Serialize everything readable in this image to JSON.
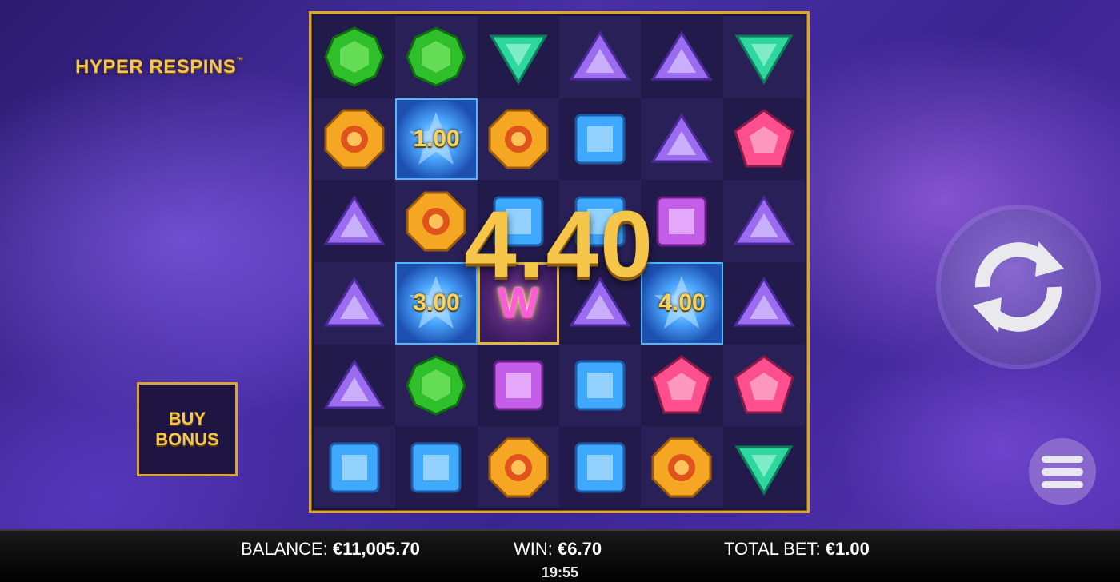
{
  "game": {
    "logo_text": "HYPER RESPINS",
    "logo_tm": "™"
  },
  "grid": {
    "rows": [
      [
        {
          "gem": "green-octagon"
        },
        {
          "gem": "green-octagon"
        },
        {
          "gem": "teal-triangle-down"
        },
        {
          "gem": "purple-triangle"
        },
        {
          "gem": "purple-triangle"
        },
        {
          "gem": "teal-triangle-down"
        }
      ],
      [
        {
          "gem": "orange-octagon"
        },
        {
          "gem": "star",
          "multiplier": "1.00"
        },
        {
          "gem": "orange-octagon"
        },
        {
          "gem": "blue-square"
        },
        {
          "gem": "purple-triangle"
        },
        {
          "gem": "pink-pentagon"
        }
      ],
      [
        {
          "gem": "purple-triangle"
        },
        {
          "gem": "orange-octagon"
        },
        {
          "gem": "blue-square"
        },
        {
          "gem": "blue-square"
        },
        {
          "gem": "magenta-square"
        },
        {
          "gem": "purple-triangle"
        }
      ],
      [
        {
          "gem": "purple-triangle"
        },
        {
          "gem": "star",
          "multiplier": "3.00"
        },
        {
          "gem": "wild",
          "letter": "W"
        },
        {
          "gem": "purple-triangle"
        },
        {
          "gem": "star",
          "multiplier": "4.00"
        },
        {
          "gem": "purple-triangle"
        }
      ],
      [
        {
          "gem": "purple-triangle"
        },
        {
          "gem": "green-octagon"
        },
        {
          "gem": "magenta-square"
        },
        {
          "gem": "blue-square"
        },
        {
          "gem": "pink-pentagon"
        },
        {
          "gem": "pink-pentagon"
        }
      ],
      [
        {
          "gem": "blue-square"
        },
        {
          "gem": "blue-square"
        },
        {
          "gem": "orange-octagon"
        },
        {
          "gem": "blue-square"
        },
        {
          "gem": "orange-octagon"
        },
        {
          "gem": "teal-triangle-down"
        }
      ]
    ],
    "big_win": "4.40"
  },
  "buy_bonus": {
    "line1": "BUY",
    "line2": "BONUS"
  },
  "controls": {
    "spin_icon": "refresh-icon",
    "menu_icon": "hamburger-icon"
  },
  "status": {
    "balance_label": "BALANCE:",
    "balance_value": "€11,005.70",
    "win_label": "WIN:",
    "win_value": "€6.70",
    "bet_label": "TOTAL BET:",
    "bet_value": "€1.00",
    "clock": "19:55"
  },
  "colors": {
    "gold": "#d9a634",
    "green": "#2fbf2a",
    "teal": "#2fd7a0",
    "purple": "#9b6cf0",
    "orange": "#f5a623",
    "blue": "#3fa8ff",
    "magenta": "#c45ee8",
    "pink": "#ff4f8f"
  }
}
